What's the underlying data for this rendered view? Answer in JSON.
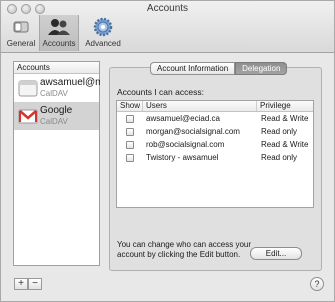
{
  "window": {
    "title": "Accounts"
  },
  "toolbar": {
    "items": [
      {
        "label": "General",
        "icon": "general-switch-icon"
      },
      {
        "label": "Accounts",
        "icon": "accounts-people-icon",
        "selected": true
      },
      {
        "label": "Advanced",
        "icon": "advanced-gear-icon"
      }
    ]
  },
  "sidebar": {
    "header": "Accounts",
    "accounts": [
      {
        "name": "awsamuel@m...",
        "type": "CalDAV",
        "icon": "caldav-calendar-icon"
      },
      {
        "name": "Google",
        "type": "CalDAV",
        "icon": "gmail-envelope-icon",
        "selected": true
      }
    ],
    "add_label": "+",
    "remove_label": "−"
  },
  "tabs": [
    {
      "label": "Account Information"
    },
    {
      "label": "Delegation",
      "active": true
    }
  ],
  "delegation": {
    "heading": "Accounts I can access:",
    "columns": [
      "Show",
      "Users",
      "Privilege"
    ],
    "rows": [
      {
        "show": false,
        "user": "awsamuel@eciad.ca",
        "privilege": "Read & Write"
      },
      {
        "show": false,
        "user": "morgan@socialsignal.com",
        "privilege": "Read only"
      },
      {
        "show": false,
        "user": "rob@socialsignal.com",
        "privilege": "Read & Write"
      },
      {
        "show": false,
        "user": "Twistory - awsamuel",
        "privilege": "Read only"
      }
    ],
    "hint": "You can change who can access your account by clicking the Edit button.",
    "edit_label": "Edit..."
  },
  "help_label": "?"
}
